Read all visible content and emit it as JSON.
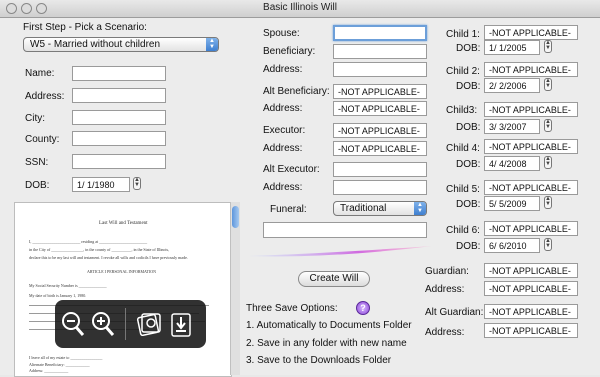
{
  "window": {
    "title": "Basic Illinois Will"
  },
  "scenario": {
    "heading": "First Step - Pick a Scenario:",
    "selected": "W5 - Married without children"
  },
  "testator": {
    "name_label": "Name:",
    "address_label": "Address:",
    "city_label": "City:",
    "county_label": "County:",
    "ssn_label": "SSN:",
    "dob_label": "DOB:",
    "dob_value": "1/  1/1980"
  },
  "middle": {
    "spouse_label": "Spouse:",
    "beneficiary_label": "Beneficiary:",
    "address_label": "Address:",
    "alt_beneficiary_label": "Alt Beneficiary:",
    "alt_beneficiary_value": "-NOT APPLICABLE-",
    "alt_beneficiary_address_value": "-NOT APPLICABLE-",
    "executor_label": "Executor:",
    "executor_value": "-NOT APPLICABLE-",
    "executor_address_value": "-NOT APPLICABLE-",
    "alt_executor_label": "Alt Executor:",
    "funeral_label": "Funeral:",
    "funeral_selected": "Traditional"
  },
  "children": [
    {
      "label": "Child 1:",
      "value": "-NOT APPLICABLE-",
      "dob": "1/  1/2005"
    },
    {
      "label": "Child 2:",
      "value": "-NOT APPLICABLE-",
      "dob": "2/  2/2006"
    },
    {
      "label": "Child3:",
      "value": "-NOT APPLICABLE-",
      "dob": "3/  3/2007"
    },
    {
      "label": "Child 4:",
      "value": "-NOT APPLICABLE-",
      "dob": "4/  4/2008"
    },
    {
      "label": "Child 5:",
      "value": "-NOT APPLICABLE-",
      "dob": "5/  5/2009"
    },
    {
      "label": "Child 6:",
      "value": "-NOT APPLICABLE-",
      "dob": "6/  6/2010"
    }
  ],
  "dob_label": "DOB:",
  "guardian": {
    "label": "Guardian:",
    "value": "-NOT APPLICABLE-",
    "address_label": "Address:",
    "address_value": "-NOT APPLICABLE-",
    "alt_label": "Alt Guardian:",
    "alt_value": "-NOT APPLICABLE-",
    "alt_address_value": "-NOT APPLICABLE-"
  },
  "actions": {
    "create_will": "Create Will",
    "save_heading": "Three Save Options:",
    "help": "?",
    "options": [
      "1. Automatically to Documents Folder",
      "2. Save in any folder with new name",
      "3. Save to the Downloads Folder"
    ]
  },
  "preview": {
    "title": "Last Will and Testament",
    "line1": "I, ________________________ residing at ________________________",
    "line2": "in the City of ________________, in the county of __________, in the State of Illinois,",
    "line3": "declare this to be my last will and testament. I revoke all wills and codicils I have previously made.",
    "article": "ARTICLE I   PERSONAL INFORMATION",
    "ssn_line": "My Social Security Number is ______________",
    "dob_line": "My date of birth is January 1, 1980.",
    "bottom1": "I leave all of my estate to ________________",
    "bottom2": "Alternate Beneficiary: ____________",
    "bottom3": "Address: ____________"
  },
  "hud": {
    "icons": [
      "zoom-out-icon",
      "zoom-in-icon",
      "view-icon",
      "save-icon"
    ]
  }
}
